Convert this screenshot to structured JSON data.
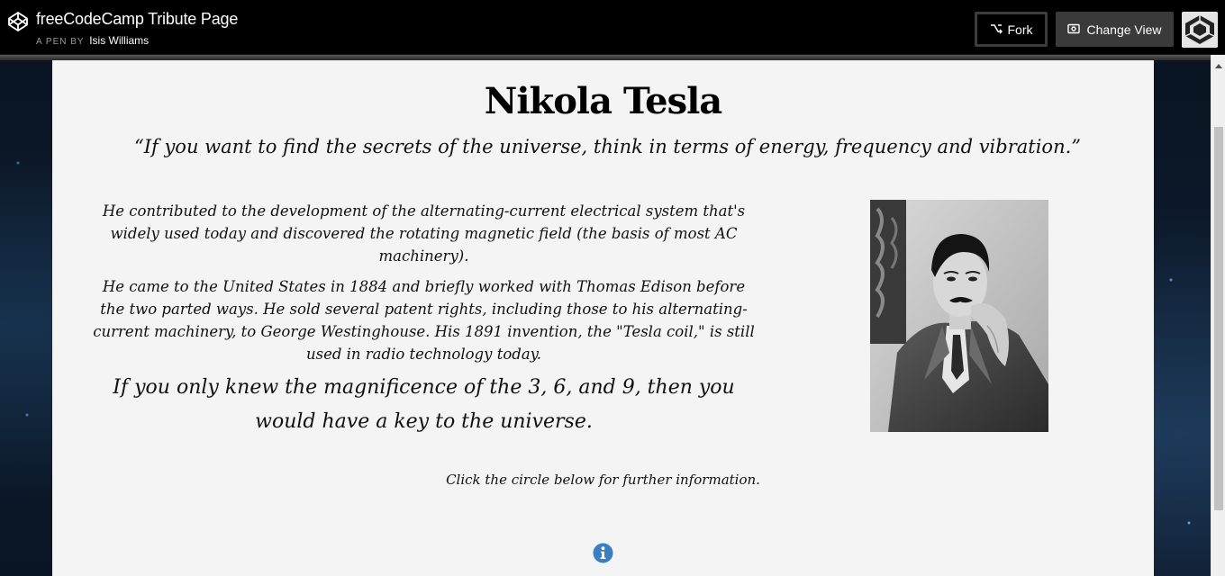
{
  "topbar": {
    "title": "freeCodeCamp Tribute Page",
    "byline_prefix": "A PEN BY",
    "author": "Isis Williams",
    "fork_label": "Fork",
    "change_view_label": "Change View"
  },
  "tribute": {
    "name": "Nikola Tesla",
    "quote": "“If you want to find the secrets of the universe, think in terms of energy, frequency and vibration.”",
    "paragraph_1": "He contributed to the development of the alternating-current electrical system that's widely used today and discovered the rotating magnetic field (the basis of most AC machinery).",
    "paragraph_2": "He came to the United States in 1884 and briefly worked with Thomas Edison before the two parted ways. He sold several patent rights, including those to his alternating-current machinery, to George Westinghouse. His 1891 invention, the \"Tesla coil,\" is still used in radio technology today.",
    "paragraph_3": "If you only knew the magnificence of the 3, 6, and 9, then you would have a key to the universe.",
    "hint": "Click the circle below for further information."
  },
  "colors": {
    "topbar_bg": "#000000",
    "card_bg": "#f4f4f4",
    "info_icon": "#3a7fc1"
  },
  "icons": {
    "brand": "codepen-logo-icon",
    "fork": "fork-icon",
    "change_view": "eye-icon",
    "info": "info-circle-icon"
  }
}
